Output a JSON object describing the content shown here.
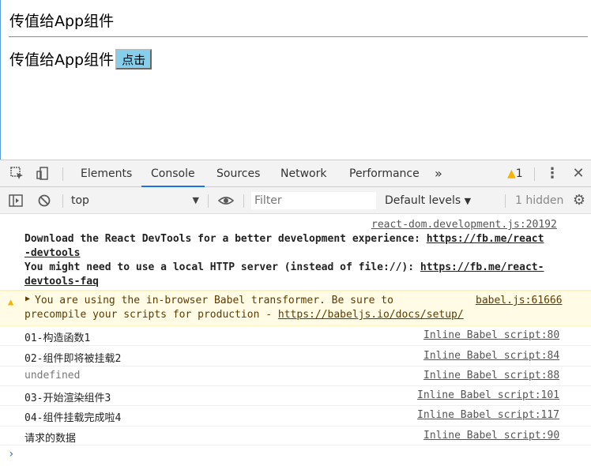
{
  "page": {
    "title": "传值给App组件",
    "row_text": "传值给App组件",
    "button_label": "点击"
  },
  "devtools": {
    "tabs": [
      "Elements",
      "Console",
      "Sources",
      "Network",
      "Performance"
    ],
    "more_tabs": "»",
    "warning_count": "1",
    "toolbar": {
      "context": "top",
      "filter_placeholder": "Filter",
      "levels": "Default levels",
      "hidden": "1 hidden"
    },
    "messages": [
      {
        "source": "react-dom.development.js:20192",
        "line1_text": "Download the React DevTools for a better development experience: ",
        "line1_link": "https://fb.me/react",
        "line2_link": "-devtools",
        "line3_text": "You might need to use a local HTTP server (instead of file://): ",
        "line3_link": "https://fb.me/react-",
        "line4_link": "devtools-faq"
      },
      {
        "source": "babel.js:61666",
        "line1_text": "You are using the in-browser Babel transformer. Be sure to",
        "line2_text": "precompile your scripts for production - ",
        "line2_link": "https://babeljs.io/docs/setup/"
      }
    ],
    "logs": [
      {
        "text": "01-构造函数1",
        "source": "Inline Babel script:80"
      },
      {
        "text": "02-组件即将被挂载2",
        "source": "Inline Babel script:84"
      },
      {
        "text": "undefined",
        "source": "Inline Babel script:88"
      },
      {
        "text": "03-开始渲染组件3",
        "source": "Inline Babel script:101"
      },
      {
        "text": "04-组件挂载完成啦4",
        "source": "Inline Babel script:117"
      },
      {
        "text": "请求的数据",
        "source": "Inline Babel script:90"
      }
    ],
    "prompt": "›"
  },
  "colors": {
    "accent": "#1a73e8",
    "warning": "#f4b400",
    "button_bg": "#87ceeb"
  }
}
